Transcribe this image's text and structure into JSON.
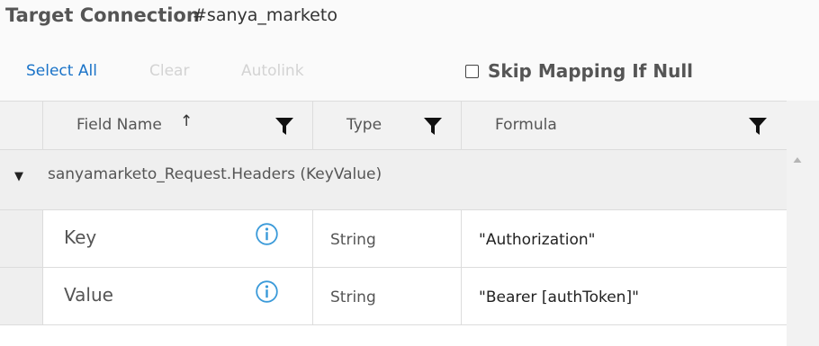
{
  "header": {
    "title": "Target Connection",
    "connection_name": "#sanya_marketo"
  },
  "toolbar": {
    "select_all": "Select All",
    "clear": "Clear",
    "autolink": "Autolink",
    "skip_mapping_label": "Skip Mapping If Null",
    "skip_mapping_checked": false
  },
  "columns": {
    "field_name": "Field Name",
    "type": "Type",
    "formula": "Formula",
    "sort_indicator": "↑"
  },
  "group": {
    "caret": "▼",
    "label": "sanyamarketo_Request.Headers (KeyValue)"
  },
  "rows": [
    {
      "field": "Key",
      "type": "String",
      "formula": "\"Authorization\""
    },
    {
      "field": "Value",
      "type": "String",
      "formula": "\"Bearer [authToken]\""
    }
  ],
  "icons": {
    "filter": "funnel-filter-icon",
    "info": "info-circle-icon",
    "scroll_up": "triangle-up-icon",
    "sort": "arrow-up-icon"
  },
  "colors": {
    "link": "#1a73c8",
    "disabled": "#d3d3d3",
    "info_icon": "#3a9ad9"
  }
}
